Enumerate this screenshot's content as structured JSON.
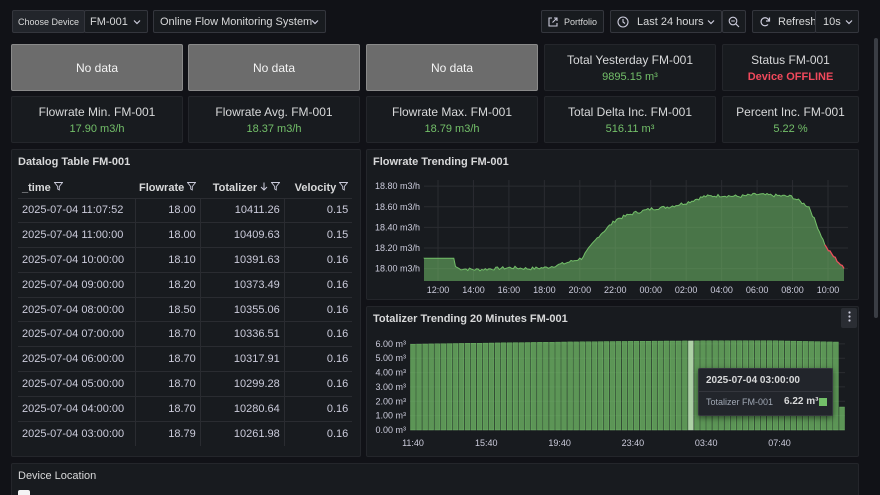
{
  "toolbar": {
    "choose_device_label": "Choose Device",
    "device_value": "FM-001",
    "dashboard_value": "Online Flow Monitoring System",
    "portfolio_label": "Portfolio",
    "time_range": "Last 24 hours",
    "refresh_label": "Refresh",
    "refresh_interval": "10s"
  },
  "row1": {
    "nodata": [
      "No data",
      "No data",
      "No data"
    ],
    "total_yesterday": {
      "title": "Total Yesterday FM-001",
      "value": "9895.15 m³"
    },
    "status": {
      "title": "Status FM-001",
      "value": "Device OFFLINE"
    }
  },
  "row2": [
    {
      "title": "Flowrate Min. FM-001",
      "value": "17.90 m3/h"
    },
    {
      "title": "Flowrate Avg. FM-001",
      "value": "18.37 m3/h"
    },
    {
      "title": "Flowrate Max. FM-001",
      "value": "18.79 m3/h"
    },
    {
      "title": "Total Delta Inc. FM-001",
      "value": "516.11 m³"
    },
    {
      "title": "Percent Inc. FM-001",
      "value": "5.22 %"
    }
  ],
  "table": {
    "title": "Datalog Table FM-001",
    "headers": {
      "time": "_time",
      "flowrate": "Flowrate",
      "totalizer": "Totalizer",
      "velocity": "Velocity"
    },
    "rows": [
      [
        "2025-07-04 11:07:52",
        "18.00",
        "10411.26",
        "0.15"
      ],
      [
        "2025-07-04 11:00:00",
        "18.00",
        "10409.63",
        "0.15"
      ],
      [
        "2025-07-04 10:00:00",
        "18.10",
        "10391.63",
        "0.16"
      ],
      [
        "2025-07-04 09:00:00",
        "18.20",
        "10373.49",
        "0.16"
      ],
      [
        "2025-07-04 08:00:00",
        "18.50",
        "10355.06",
        "0.16"
      ],
      [
        "2025-07-04 07:00:00",
        "18.70",
        "10336.51",
        "0.16"
      ],
      [
        "2025-07-04 06:00:00",
        "18.70",
        "10317.91",
        "0.16"
      ],
      [
        "2025-07-04 05:00:00",
        "18.70",
        "10299.28",
        "0.16"
      ],
      [
        "2025-07-04 04:00:00",
        "18.70",
        "10280.64",
        "0.16"
      ],
      [
        "2025-07-04 03:00:00",
        "18.79",
        "10261.98",
        "0.16"
      ]
    ]
  },
  "flow_chart_title": "Flowrate Trending FM-001",
  "totalizer_chart_title": "Totalizer Trending 20 Minutes FM-001",
  "tooltip": {
    "time": "2025-07-04 03:00:00",
    "series": "Totalizer FM-001",
    "value": "6.22 m³"
  },
  "location_title": "Device Location",
  "colors": {
    "green": "#73bf69",
    "red": "#f2495c",
    "bg": "#111217",
    "panel": "#181b1f"
  },
  "chart_data": [
    {
      "type": "area",
      "ylim": [
        17.88,
        18.86
      ],
      "y_ticks": [
        "18.00 m3/h",
        "18.20 m3/h",
        "18.40 m3/h",
        "18.60 m3/h",
        "18.80 m3/h"
      ],
      "y_tick_values": [
        18.0,
        18.2,
        18.4,
        18.6,
        18.8
      ],
      "x_ticks": [
        "12:00",
        "14:00",
        "16:00",
        "18:00",
        "20:00",
        "22:00",
        "00:00",
        "02:00",
        "04:00",
        "06:00",
        "08:00",
        "10:00"
      ],
      "x_hours": [
        0,
        1,
        2,
        3,
        4,
        5,
        6,
        7,
        8,
        9,
        10,
        11,
        12,
        13,
        14,
        15,
        16,
        17,
        18,
        19,
        20,
        21,
        22,
        23,
        24
      ],
      "values": [
        18.1,
        18.1,
        18.0,
        17.99,
        18.0,
        18.01,
        18.0,
        18.01,
        18.05,
        18.1,
        18.32,
        18.48,
        18.54,
        18.58,
        18.6,
        18.64,
        18.7,
        18.71,
        18.7,
        18.72,
        18.71,
        18.7,
        18.6,
        18.2,
        18.0
      ]
    },
    {
      "type": "bar",
      "ylim": [
        0,
        6.2
      ],
      "y_ticks": [
        "0.00 m³",
        "1.00 m³",
        "2.00 m³",
        "3.00 m³",
        "4.00 m³",
        "5.00 m³",
        "6.00 m³"
      ],
      "y_tick_values": [
        0,
        1,
        2,
        3,
        4,
        5,
        6
      ],
      "x_ticks": [
        "11:40",
        "15:40",
        "19:40",
        "23:40",
        "03:40",
        "07:40"
      ],
      "bar_count": 72,
      "values_start": 5.98,
      "values_peak": 6.22,
      "last_value": 1.6,
      "highlight_index": 46
    }
  ]
}
